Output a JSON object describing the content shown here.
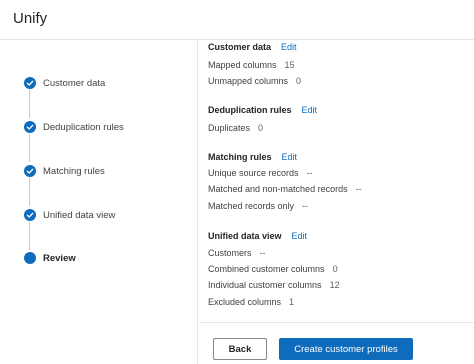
{
  "app": {
    "title": "Unify"
  },
  "steps": [
    {
      "label": "Customer data",
      "state": "done"
    },
    {
      "label": "Deduplication rules",
      "state": "done"
    },
    {
      "label": "Matching rules",
      "state": "done"
    },
    {
      "label": "Unified data view",
      "state": "done"
    },
    {
      "label": "Review",
      "state": "current"
    }
  ],
  "sections": {
    "customer_data": {
      "title": "Customer data",
      "edit": "Edit",
      "rows": [
        {
          "label": "Mapped columns",
          "value": "15"
        },
        {
          "label": "Unmapped columns",
          "value": "0"
        }
      ]
    },
    "deduplication": {
      "title": "Deduplication rules",
      "edit": "Edit",
      "rows": [
        {
          "label": "Duplicates",
          "value": "0"
        }
      ]
    },
    "matching": {
      "title": "Matching rules",
      "edit": "Edit",
      "rows": [
        {
          "label": "Unique source records",
          "value": "--"
        },
        {
          "label": "Matched and non-matched records",
          "value": "--"
        },
        {
          "label": "Matched records only",
          "value": "--"
        }
      ]
    },
    "unified_view": {
      "title": "Unified data view",
      "edit": "Edit",
      "rows": [
        {
          "label": "Customers",
          "value": "--"
        },
        {
          "label": "Combined customer columns",
          "value": "0"
        },
        {
          "label": "Individual customer columns",
          "value": "12"
        },
        {
          "label": "Excluded columns",
          "value": "1"
        }
      ]
    }
  },
  "footer": {
    "back_label": "Back",
    "create_label": "Create customer profiles"
  },
  "colors": {
    "accent": "#0f6cbd",
    "text": "#242424",
    "divider": "#e6e6e6"
  },
  "icons": {
    "done": "checkmark-circle-icon",
    "current": "filled-circle-icon"
  }
}
